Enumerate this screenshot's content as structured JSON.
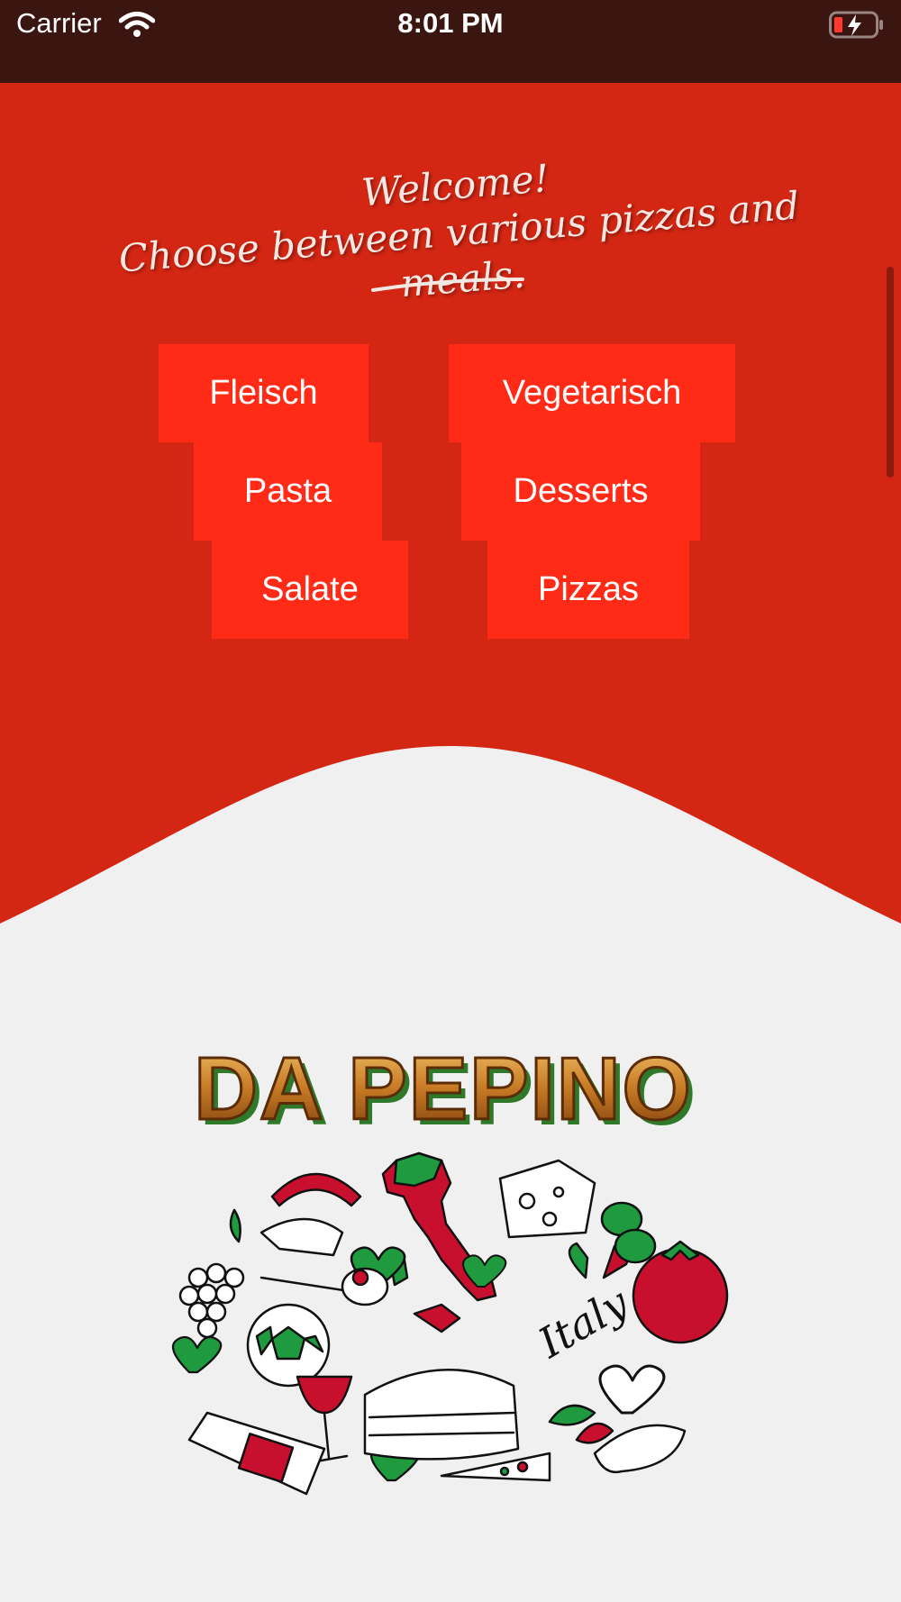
{
  "status_bar": {
    "carrier": "Carrier",
    "time": "8:01 PM",
    "wifi_icon": "wifi-icon",
    "battery_icon": "battery-charging-icon"
  },
  "welcome": {
    "line1": "Welcome!",
    "line2": "Choose between various pizzas and meals."
  },
  "categories": {
    "fleisch": "Fleisch",
    "vegetarisch": "Vegetarisch",
    "pasta": "Pasta",
    "desserts": "Desserts",
    "salate": "Salate",
    "pizzas": "Pizzas"
  },
  "logo": {
    "brand": "DA PEPINO",
    "illustration_text": "Italy"
  },
  "colors": {
    "status_bar": "#3b1510",
    "header_red": "#d32613",
    "button_red": "#ff2b16",
    "background": "#f0f0f0",
    "italy_green": "#1f9a3e",
    "italy_red": "#c8102e"
  }
}
